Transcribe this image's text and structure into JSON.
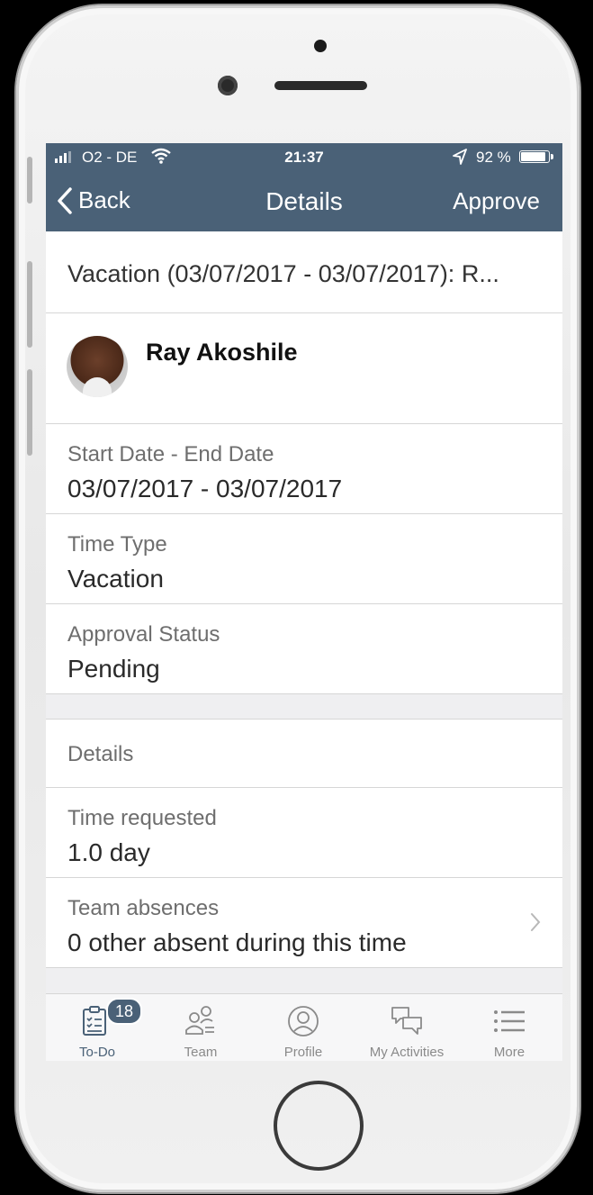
{
  "status_bar": {
    "carrier": "O2 - DE",
    "time": "21:37",
    "battery": "92 %",
    "battery_level": 0.92
  },
  "nav": {
    "back_label": "Back",
    "title": "Details",
    "approve_label": "Approve"
  },
  "request": {
    "headline": "Vacation (03/07/2017 - 03/07/2017): R...",
    "person_name": "Ray Akoshile",
    "fields": [
      {
        "label": "Start Date - End Date",
        "value": "03/07/2017 - 03/07/2017"
      },
      {
        "label": "Time Type",
        "value": "Vacation"
      },
      {
        "label": "Approval Status",
        "value": "Pending"
      }
    ]
  },
  "details": {
    "section_title": "Details",
    "fields": [
      {
        "label": "Time requested",
        "value": "1.0 day"
      },
      {
        "label": "Team absences",
        "value": "0 other absent during this time"
      }
    ]
  },
  "tabs": [
    {
      "label": "To-Do",
      "icon": "clipboard-checklist-icon",
      "badge": "18",
      "active": true
    },
    {
      "label": "Team",
      "icon": "team-icon",
      "active": false
    },
    {
      "label": "Profile",
      "icon": "profile-icon",
      "active": false
    },
    {
      "label": "My Activities",
      "icon": "chat-bubbles-icon",
      "active": false
    },
    {
      "label": "More",
      "icon": "list-menu-icon",
      "active": false
    }
  ],
  "colors": {
    "header": "#4a6177",
    "background": "#efeff1"
  }
}
